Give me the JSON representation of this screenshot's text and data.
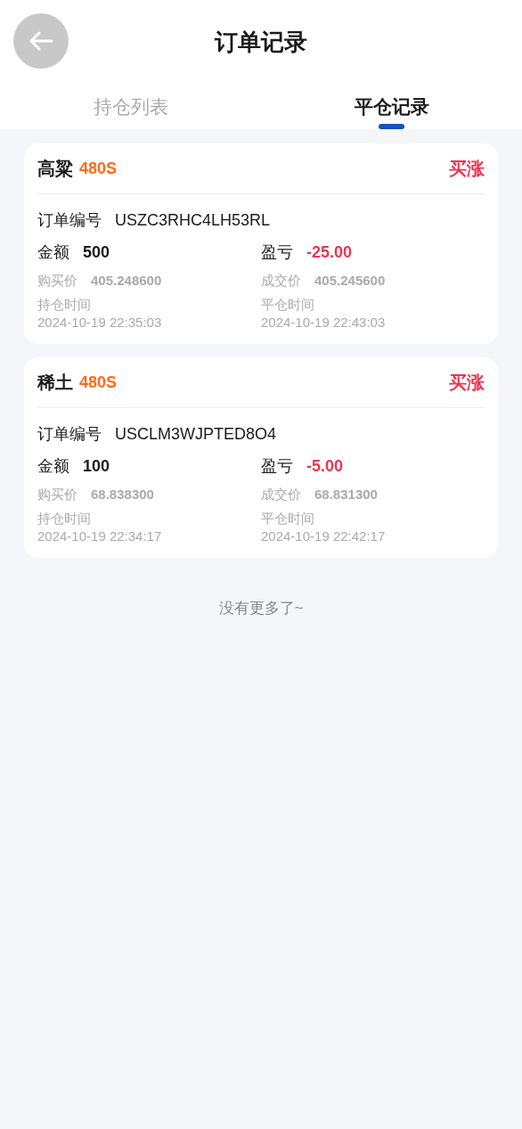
{
  "header": {
    "title": "订单记录"
  },
  "tabs": [
    {
      "label": "持仓列表",
      "selected": false
    },
    {
      "label": "平仓记录",
      "selected": true
    }
  ],
  "orders": [
    {
      "name": "高粱",
      "period": "480S",
      "direction": "买涨",
      "order_no_label": "订单编号",
      "order_no": "USZC3RHC4LH53RL",
      "amount_label": "金额",
      "amount": "500",
      "pnl_label": "盈亏",
      "pnl": "-25.00",
      "buy_price_label": "购买价",
      "buy_price": "405.248600",
      "deal_price_label": "成交价",
      "deal_price": "405.245600",
      "open_time_label": "持仓时间",
      "open_time": "2024-10-19 22:35:03",
      "close_time_label": "平仓时间",
      "close_time": "2024-10-19 22:43:03"
    },
    {
      "name": "稀土",
      "period": "480S",
      "direction": "买涨",
      "order_no_label": "订单编号",
      "order_no": "USCLM3WJPTED8O4",
      "amount_label": "金额",
      "amount": "100",
      "pnl_label": "盈亏",
      "pnl": "-5.00",
      "buy_price_label": "购买价",
      "buy_price": "68.838300",
      "deal_price_label": "成交价",
      "deal_price": "68.831300",
      "open_time_label": "持仓时间",
      "open_time": "2024-10-19 22:34:17",
      "close_time_label": "平仓时间",
      "close_time": "2024-10-19 22:42:17"
    }
  ],
  "footer": "没有更多了~"
}
